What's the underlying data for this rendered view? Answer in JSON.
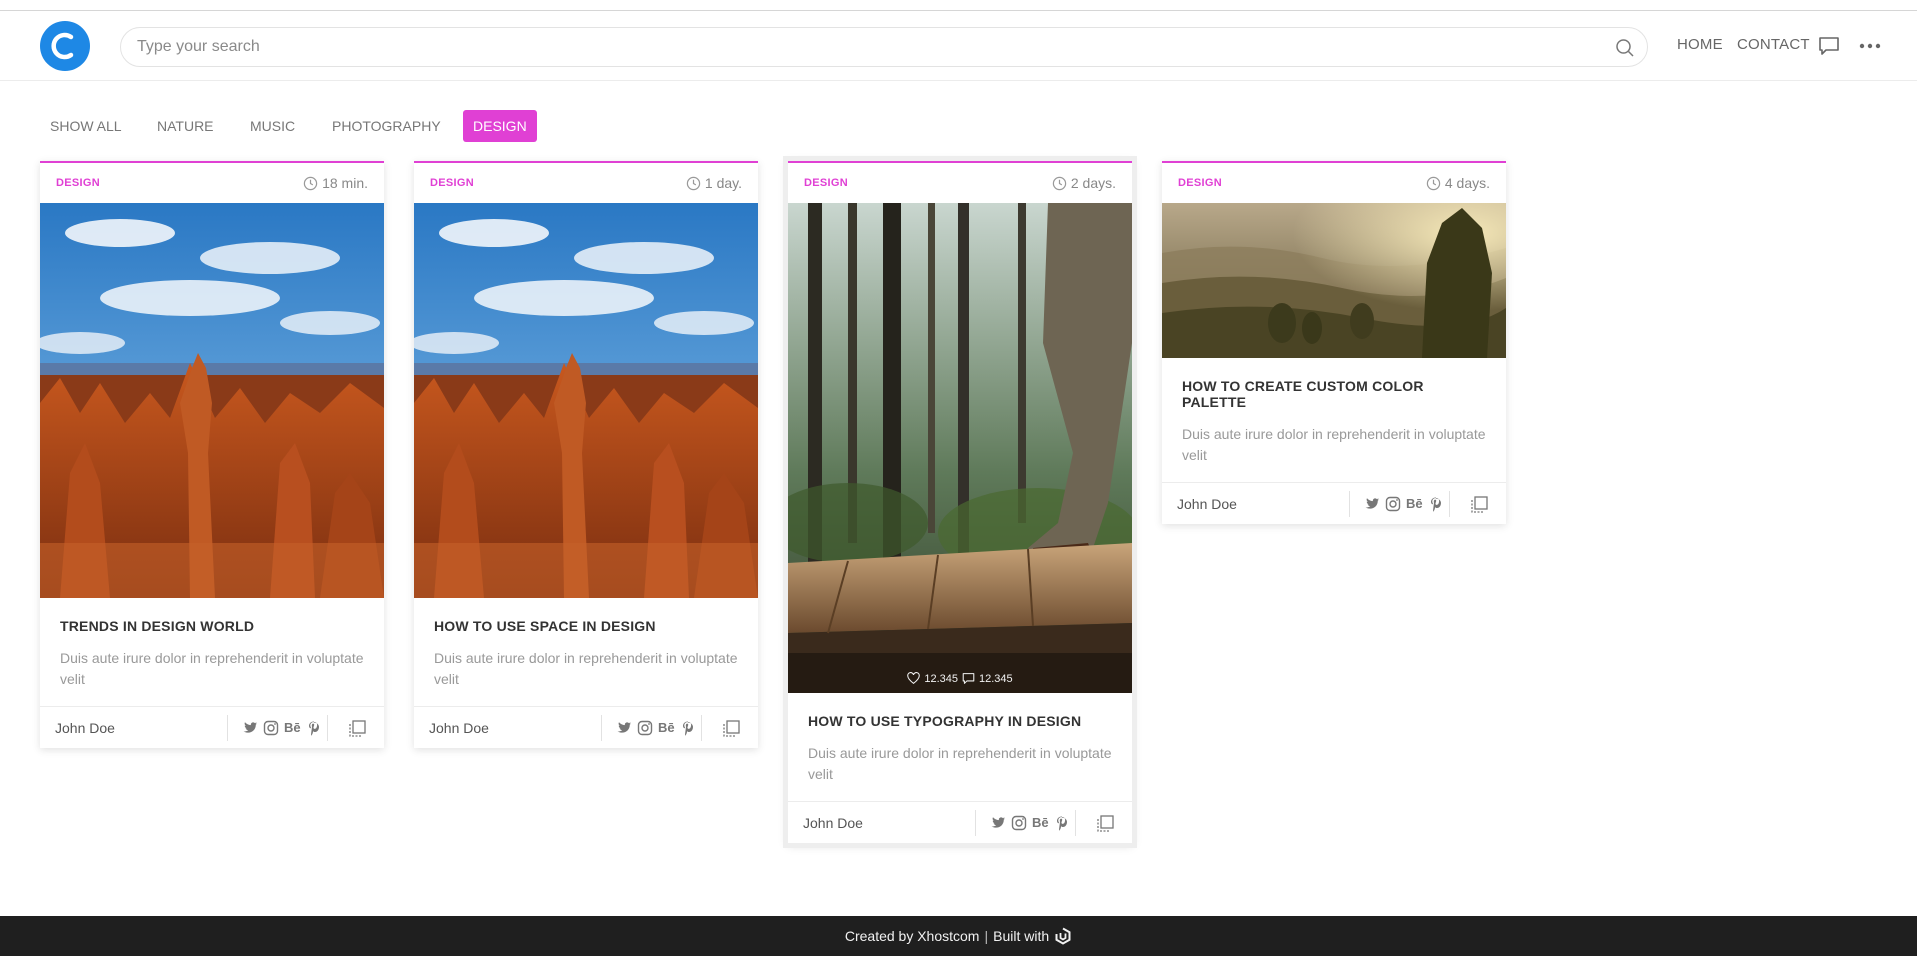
{
  "header": {
    "search_placeholder": "Type your search",
    "nav": {
      "home": "HOME",
      "contact": "CONTACT"
    },
    "icons": [
      "logo-c-icon",
      "search-icon",
      "chat-icon",
      "more-dots-icon"
    ]
  },
  "filters": {
    "items": [
      {
        "label": "SHOW ALL"
      },
      {
        "label": "NATURE"
      },
      {
        "label": "MUSIC"
      },
      {
        "label": "PHOTOGRAPHY"
      },
      {
        "label": "DESIGN"
      }
    ],
    "active": "DESIGN"
  },
  "cards": [
    {
      "category": "DESIGN",
      "time": "18 min.",
      "title": "TRENDS IN DESIGN WORLD",
      "description": "Duis aute irure dolor in reprehenderit in voluptate velit",
      "author": "John Doe",
      "image": "canyon-hoodoos"
    },
    {
      "category": "DESIGN",
      "time": "1 day.",
      "title": "HOW TO USE SPACE IN DESIGN",
      "description": "Duis aute irure dolor in reprehenderit in voluptate velit",
      "author": "John Doe",
      "image": "canyon-hoodoos"
    },
    {
      "category": "DESIGN",
      "time": "2 days.",
      "title": "HOW TO USE TYPOGRAPHY IN DESIGN",
      "description": "Duis aute irure dolor in reprehenderit in voluptate velit",
      "author": "John Doe",
      "image": "forest-walk",
      "likes": "12.345",
      "comments": "12.345"
    },
    {
      "category": "DESIGN",
      "time": "4 days.",
      "title": "HOW TO CREATE CUSTOM COLOR PALETTE",
      "description": "Duis aute irure dolor in reprehenderit in voluptate velit",
      "author": "John Doe",
      "image": "hills-sunrise"
    }
  ],
  "social": {
    "behance": "Bē"
  },
  "footer": {
    "created_by": "Created by Xhostcom",
    "separator": "|",
    "built_with": "Built with"
  },
  "colors": {
    "accent": "#e040d4",
    "brand": "#1e88e5",
    "footer_bg": "#1f1f1f"
  }
}
